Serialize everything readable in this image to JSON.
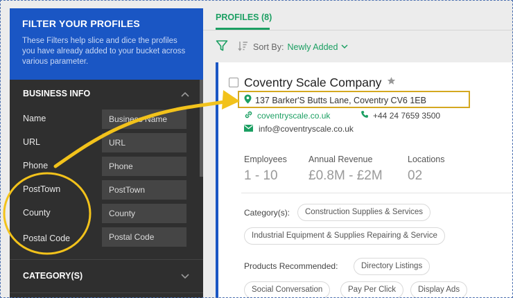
{
  "filter": {
    "title": "FILTER YOUR PROFILES",
    "description": "These Filters help slice and dice the profiles you have already added to your bucket across various parameter."
  },
  "business_info": {
    "title": "BUSINESS INFO",
    "fields": [
      {
        "label": "Name",
        "placeholder": "Business Name"
      },
      {
        "label": "URL",
        "placeholder": "URL"
      },
      {
        "label": "Phone",
        "placeholder": "Phone"
      },
      {
        "label": "PostTown",
        "placeholder": "PostTown"
      },
      {
        "label": "County",
        "placeholder": "County"
      },
      {
        "label": "Postal Code",
        "placeholder": "Postal Code"
      }
    ]
  },
  "category_section": {
    "title": "CATEGORY(S)"
  },
  "tabs": {
    "profiles": "PROFILES (8)"
  },
  "sort": {
    "label": "Sort By:",
    "value": "Newly Added"
  },
  "profile": {
    "company": "Coventry Scale Company",
    "address": "137 Barker'S Butts Lane, Coventry CV6 1EB",
    "website": "coventryscale.co.uk",
    "phone": "+44 24 7659 3500",
    "email": "info@coventryscale.co.uk",
    "stats": [
      {
        "label": "Employees",
        "value": "1 - 10"
      },
      {
        "label": "Annual Revenue",
        "value": "£0.8M - £2M"
      },
      {
        "label": "Locations",
        "value": "02"
      }
    ],
    "categories_label": "Category(s):",
    "categories": [
      "Construction Supplies & Services",
      "Industrial Equipment & Supplies Repairing & Service"
    ],
    "products_label": "Products Recommended:",
    "products": [
      "Directory Listings",
      "Social Conversation",
      "Pay Per Click",
      "Display Ads"
    ]
  },
  "colors": {
    "accent_green": "#1b9f62",
    "brand_blue": "#1a56c4",
    "highlight_gold": "#d4a820"
  }
}
